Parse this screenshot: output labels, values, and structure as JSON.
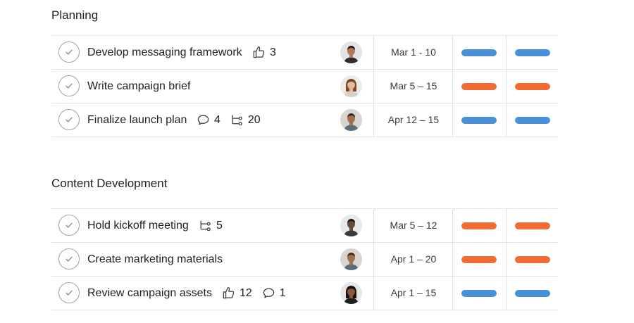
{
  "colors": {
    "blue": "#4a90d6",
    "orange": "#f26b35",
    "text": "#1e1f21",
    "muted": "#a2a2a2"
  },
  "sections": [
    {
      "title": "Planning",
      "tasks": [
        {
          "name": "Develop messaging framework",
          "metas": [
            {
              "icon": "thumbs-up-icon",
              "count": "3"
            }
          ],
          "assignee": "avatar-1",
          "date": "Mar 1 - 10",
          "pills": [
            "blue",
            "blue"
          ]
        },
        {
          "name": "Write campaign brief",
          "metas": [],
          "assignee": "avatar-2",
          "date": "Mar 5 – 15",
          "pills": [
            "orange",
            "orange"
          ]
        },
        {
          "name": "Finalize launch plan",
          "metas": [
            {
              "icon": "comment-icon",
              "count": "4"
            },
            {
              "icon": "subtask-icon",
              "count": "20"
            }
          ],
          "assignee": "avatar-3",
          "date": "Apr 12 – 15",
          "pills": [
            "blue",
            "blue"
          ]
        }
      ]
    },
    {
      "title": "Content Development",
      "tasks": [
        {
          "name": "Hold kickoff meeting",
          "metas": [
            {
              "icon": "subtask-icon",
              "count": "5"
            }
          ],
          "assignee": "avatar-4",
          "date": "Mar 5 – 12",
          "pills": [
            "orange",
            "orange"
          ]
        },
        {
          "name": "Create marketing materials",
          "metas": [],
          "assignee": "avatar-3",
          "date": "Apr 1 – 20",
          "pills": [
            "orange",
            "orange"
          ]
        },
        {
          "name": "Review campaign assets",
          "metas": [
            {
              "icon": "thumbs-up-icon",
              "count": "12"
            },
            {
              "icon": "comment-icon",
              "count": "1"
            }
          ],
          "assignee": "avatar-5",
          "date": "Apr 1 – 15",
          "pills": [
            "blue",
            "blue"
          ]
        }
      ]
    }
  ]
}
